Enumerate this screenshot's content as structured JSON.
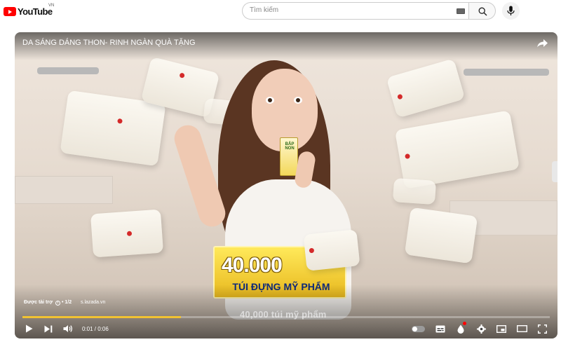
{
  "header": {
    "logo_text": "YouTube",
    "country_code": "VN",
    "search_placeholder": "Tìm kiếm"
  },
  "player": {
    "ad_title": "DA SÁNG DÁNG THON- RINH NGÀN QUÀ TẶNG",
    "sponsored_label": "Được tài trợ",
    "ad_counter": "1/2",
    "advertiser_url": "s.lazada.vn",
    "caption": "40,000 túi mỹ phẩm",
    "current_time": "0:01",
    "duration": "0:06",
    "time_display": "0:01 / 0:06",
    "progress_fraction": 0.3,
    "buffered_fraction": 0.05,
    "accent_color": "#f1c232"
  },
  "video_overlay": {
    "promo_number": "40.000",
    "promo_text": "TÚI ĐỰNG MỸ PHẨM",
    "pack_text": "BẮP NON"
  },
  "icons": [
    "youtube-logo-icon",
    "keyboard-icon",
    "search-icon",
    "microphone-icon",
    "share-icon",
    "play-icon",
    "next-icon",
    "volume-icon",
    "autoplay-toggle-icon",
    "subtitles-icon",
    "ambient-icon",
    "settings-icon",
    "miniplayer-icon",
    "theater-icon",
    "fullscreen-icon",
    "info-icon"
  ]
}
